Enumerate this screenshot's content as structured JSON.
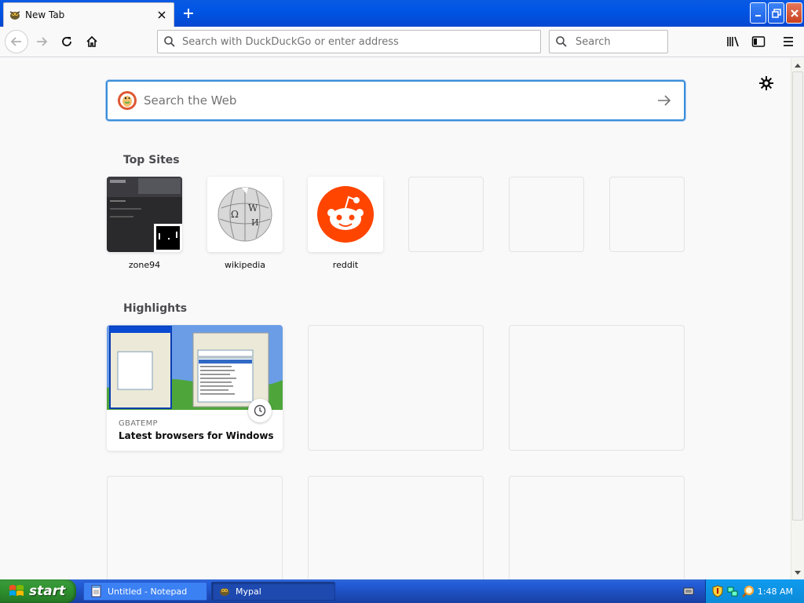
{
  "browser": {
    "tab_title": "New Tab",
    "url_placeholder": "Search with DuckDuckGo or enter address",
    "search_placeholder": "Search"
  },
  "newtab": {
    "web_search_placeholder": "Search the Web",
    "top_sites_title": "Top Sites",
    "top_sites": [
      {
        "label": "zone94"
      },
      {
        "label": "wikipedia"
      },
      {
        "label": "reddit"
      }
    ],
    "highlights_title": "Highlights",
    "highlights": [
      {
        "source": "GBATEMP",
        "title": "Latest browsers for Windows XP…"
      }
    ]
  },
  "taskbar": {
    "start_label": "start",
    "items": [
      {
        "label": "Untitled - Notepad"
      },
      {
        "label": "Mypal"
      }
    ],
    "clock": "1:48 AM"
  },
  "colors": {
    "accent": "#3a8fd8",
    "reddit": "#ff4500",
    "xp_blue": "#0055e5",
    "xp_green": "#2d8f2d"
  }
}
